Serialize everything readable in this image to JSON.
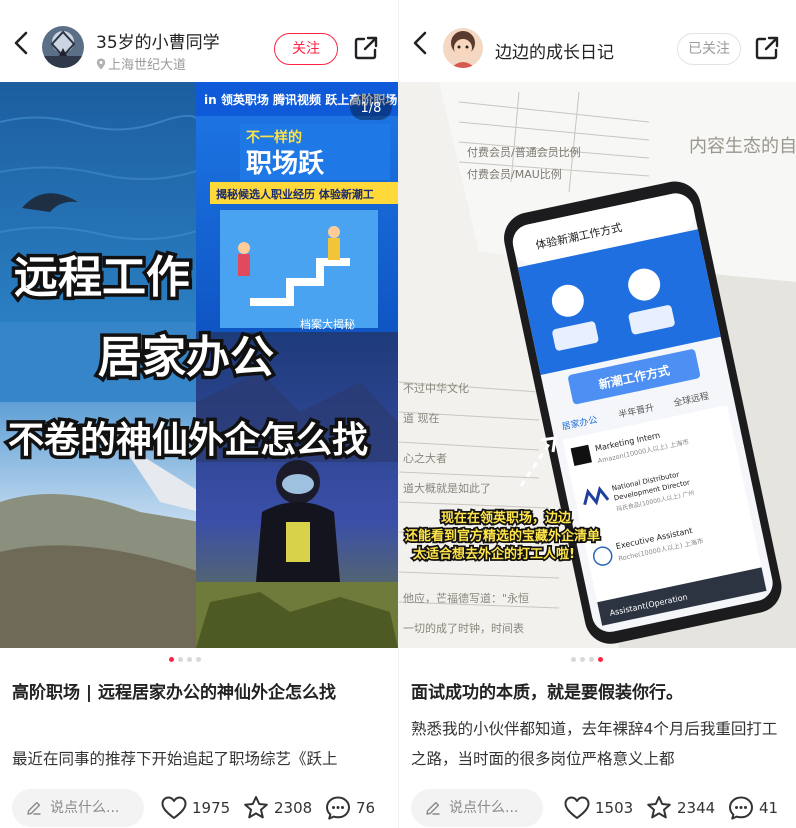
{
  "left_post": {
    "author": "35岁的小曹同学",
    "location": "上海世纪大道",
    "follow_label": "关注",
    "image_counter": "1/8",
    "image_caption": [
      "远程工作",
      "居家办公",
      "不卷的神仙外企怎么找"
    ],
    "image_banner": {
      "brands": "领英职场 | 腾讯视频 | 跃上高阶职场",
      "headline": "不一样的 职场跃",
      "subline": "揭秘候选人职业经历  体验新潮工",
      "footer": "档案大揭秘"
    },
    "title": "高阶职场 | 远程居家办公的神仙外企怎么找",
    "excerpt": "最近在同事的推荐下开始追起了职场综艺《跃上",
    "comment_placeholder": "说点什么...",
    "likes": "1975",
    "collects": "2308",
    "comments": "76",
    "page_dots": 4,
    "active_dot": 0
  },
  "right_post": {
    "author": "边边的成长日记",
    "follow_label": "已关注",
    "image_caption": [
      "现在在领英职场，边边",
      "还能看到官方精选的宝藏外企清单",
      "太适合想去外企的打工人啦!"
    ],
    "phone_screen": {
      "top_title": "体验新潮工作方式",
      "tabs": [
        "居家办公",
        "半年晋升",
        "全球远程"
      ],
      "banner": "新潮工作方式",
      "jobs": [
        {
          "title": "Marketing Intern",
          "company": "Amazon(10000人以上)  上海市"
        },
        {
          "title": "National Distributor Development Director",
          "company": "玛氏食品(10000人以上)  广州"
        },
        {
          "title": "Executive Assistant",
          "company": "Roche(10000人以上)  上海市"
        },
        {
          "title": "Assistant(Operation",
          "company": ""
        }
      ]
    },
    "title": "面试成功的本质，就是要假装你行。",
    "excerpt": "熟悉我的小伙伴都知道，去年裸辞4个月后我重回打工之路，当时面的很多岗位严格意义上都",
    "comment_placeholder": "说点什么...",
    "likes": "1503",
    "collects": "2344",
    "comments": "41",
    "page_dots": 4,
    "active_dot": 3
  },
  "colors": {
    "accent": "#ff2442",
    "muted": "#9a9a9a",
    "input_bg": "#f3f3f3"
  }
}
